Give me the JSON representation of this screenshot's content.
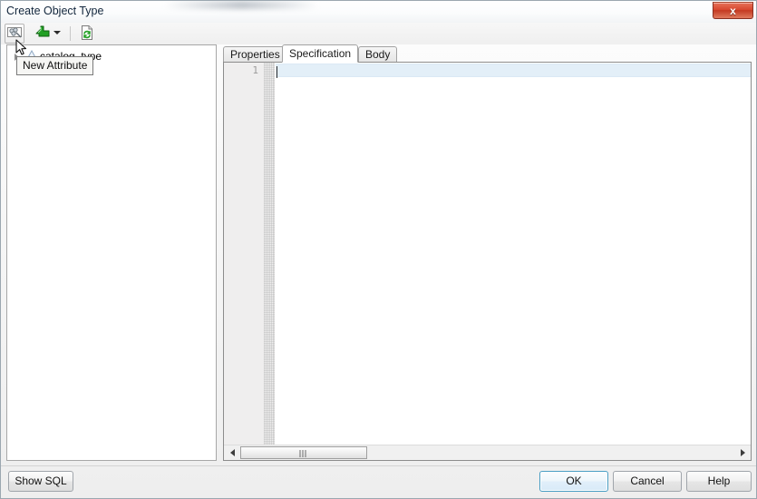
{
  "window": {
    "title": "Create Object Type",
    "close_label": "x",
    "close_icon": "close-icon"
  },
  "toolbar": {
    "buttons": [
      {
        "name": "new-attribute-button",
        "icon": "new-attribute-icon",
        "tooltip": "New Attribute",
        "hovered": true
      },
      {
        "name": "insert-button",
        "icon": "green-arrow-icon",
        "tooltip": ""
      },
      {
        "name": "insert-dropdown",
        "icon": "chevron-down-icon",
        "tooltip": ""
      },
      {
        "name": "refresh-button",
        "icon": "refresh-document-icon",
        "tooltip": ""
      }
    ],
    "tooltip_text": "New Attribute"
  },
  "tree": {
    "nodes": [
      {
        "label": "catalog_type",
        "icon": "object-type-icon",
        "expanded": false
      }
    ]
  },
  "tabs": [
    {
      "label": "Properties",
      "selected": false
    },
    {
      "label": "Specification",
      "selected": true
    },
    {
      "label": "Body",
      "selected": false
    }
  ],
  "editor": {
    "line_numbers": [
      "1"
    ],
    "lines": [
      ""
    ],
    "current_line": 1,
    "highlight_color": "#e3eff8"
  },
  "scrollbar": {
    "left_arrow_icon": "triangle-left-icon",
    "right_arrow_icon": "triangle-right-icon",
    "grip_icon": "grip-icon"
  },
  "buttons": {
    "show_sql": "Show SQL",
    "ok": "OK",
    "cancel": "Cancel",
    "help": "Help"
  },
  "colors": {
    "close_button": "#d8482f",
    "default_button_border": "#4a9ec4",
    "line_highlight": "#e3eff8",
    "green_icon": "#22a024"
  }
}
